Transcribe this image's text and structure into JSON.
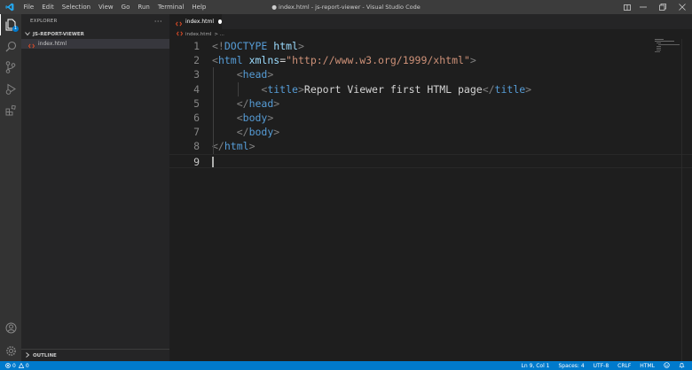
{
  "window": {
    "title": "● index.html - js-report-viewer - Visual Studio Code",
    "menu": [
      "File",
      "Edit",
      "Selection",
      "View",
      "Go",
      "Run",
      "Terminal",
      "Help"
    ]
  },
  "activity_bar": {
    "items": [
      "explorer-icon",
      "search-icon",
      "source-control-icon",
      "run-debug-icon",
      "extensions-icon"
    ],
    "bottom": [
      "account-icon",
      "settings-gear-icon"
    ],
    "explorer_badge": "1"
  },
  "sidebar": {
    "title": "EXPLORER",
    "more": "···",
    "folder": "JS-REPORT-VIEWER",
    "files": [
      "index.html"
    ],
    "outline": "OUTLINE"
  },
  "editor": {
    "tab": "index.html",
    "breadcrumb": {
      "file": "index.html",
      "more": "> ..."
    },
    "lines": [
      {
        "n": "1",
        "parts": [
          [
            "t",
            "<!"
          ],
          [
            "tg",
            "DOCTYPE"
          ],
          [
            "tx",
            " "
          ],
          [
            "at",
            "html"
          ],
          [
            "t",
            ">"
          ]
        ]
      },
      {
        "n": "2",
        "parts": [
          [
            "t",
            "<"
          ],
          [
            "tg",
            "html"
          ],
          [
            "tx",
            " "
          ],
          [
            "at",
            "xmlns"
          ],
          [
            "tx",
            "="
          ],
          [
            "st",
            "\"http://www.w3.org/1999/xhtml\""
          ],
          [
            "t",
            ">"
          ]
        ]
      },
      {
        "n": "3",
        "parts": [
          [
            "tx",
            "    "
          ],
          [
            "t",
            "<"
          ],
          [
            "tg",
            "head"
          ],
          [
            "t",
            ">"
          ]
        ]
      },
      {
        "n": "4",
        "parts": [
          [
            "tx",
            "        "
          ],
          [
            "t",
            "<"
          ],
          [
            "tg",
            "title"
          ],
          [
            "t",
            ">"
          ],
          [
            "tx",
            "Report Viewer first HTML page"
          ],
          [
            "t",
            "</"
          ],
          [
            "tg",
            "title"
          ],
          [
            "t",
            ">"
          ]
        ]
      },
      {
        "n": "5",
        "parts": [
          [
            "tx",
            "    "
          ],
          [
            "t",
            "</"
          ],
          [
            "tg",
            "head"
          ],
          [
            "t",
            ">"
          ]
        ]
      },
      {
        "n": "6",
        "parts": [
          [
            "tx",
            "    "
          ],
          [
            "t",
            "<"
          ],
          [
            "tg",
            "body"
          ],
          [
            "t",
            ">"
          ]
        ]
      },
      {
        "n": "7",
        "parts": [
          [
            "tx",
            "    "
          ],
          [
            "t",
            "</"
          ],
          [
            "tg",
            "body"
          ],
          [
            "t",
            ">"
          ]
        ]
      },
      {
        "n": "8",
        "parts": [
          [
            "t",
            "</"
          ],
          [
            "tg",
            "html"
          ],
          [
            "t",
            ">"
          ]
        ]
      },
      {
        "n": "9",
        "parts": []
      }
    ],
    "current_line": "9"
  },
  "status_bar": {
    "errors": "0",
    "warnings": "0",
    "position": "Ln 9, Col 1",
    "spaces": "Spaces: 4",
    "encoding": "UTF-8",
    "eol": "CRLF",
    "language": "HTML"
  },
  "colors": {
    "accent": "#007acc",
    "tag": "#569cd6",
    "attr": "#9cdcfe",
    "string": "#ce9178",
    "punct": "#808080"
  }
}
